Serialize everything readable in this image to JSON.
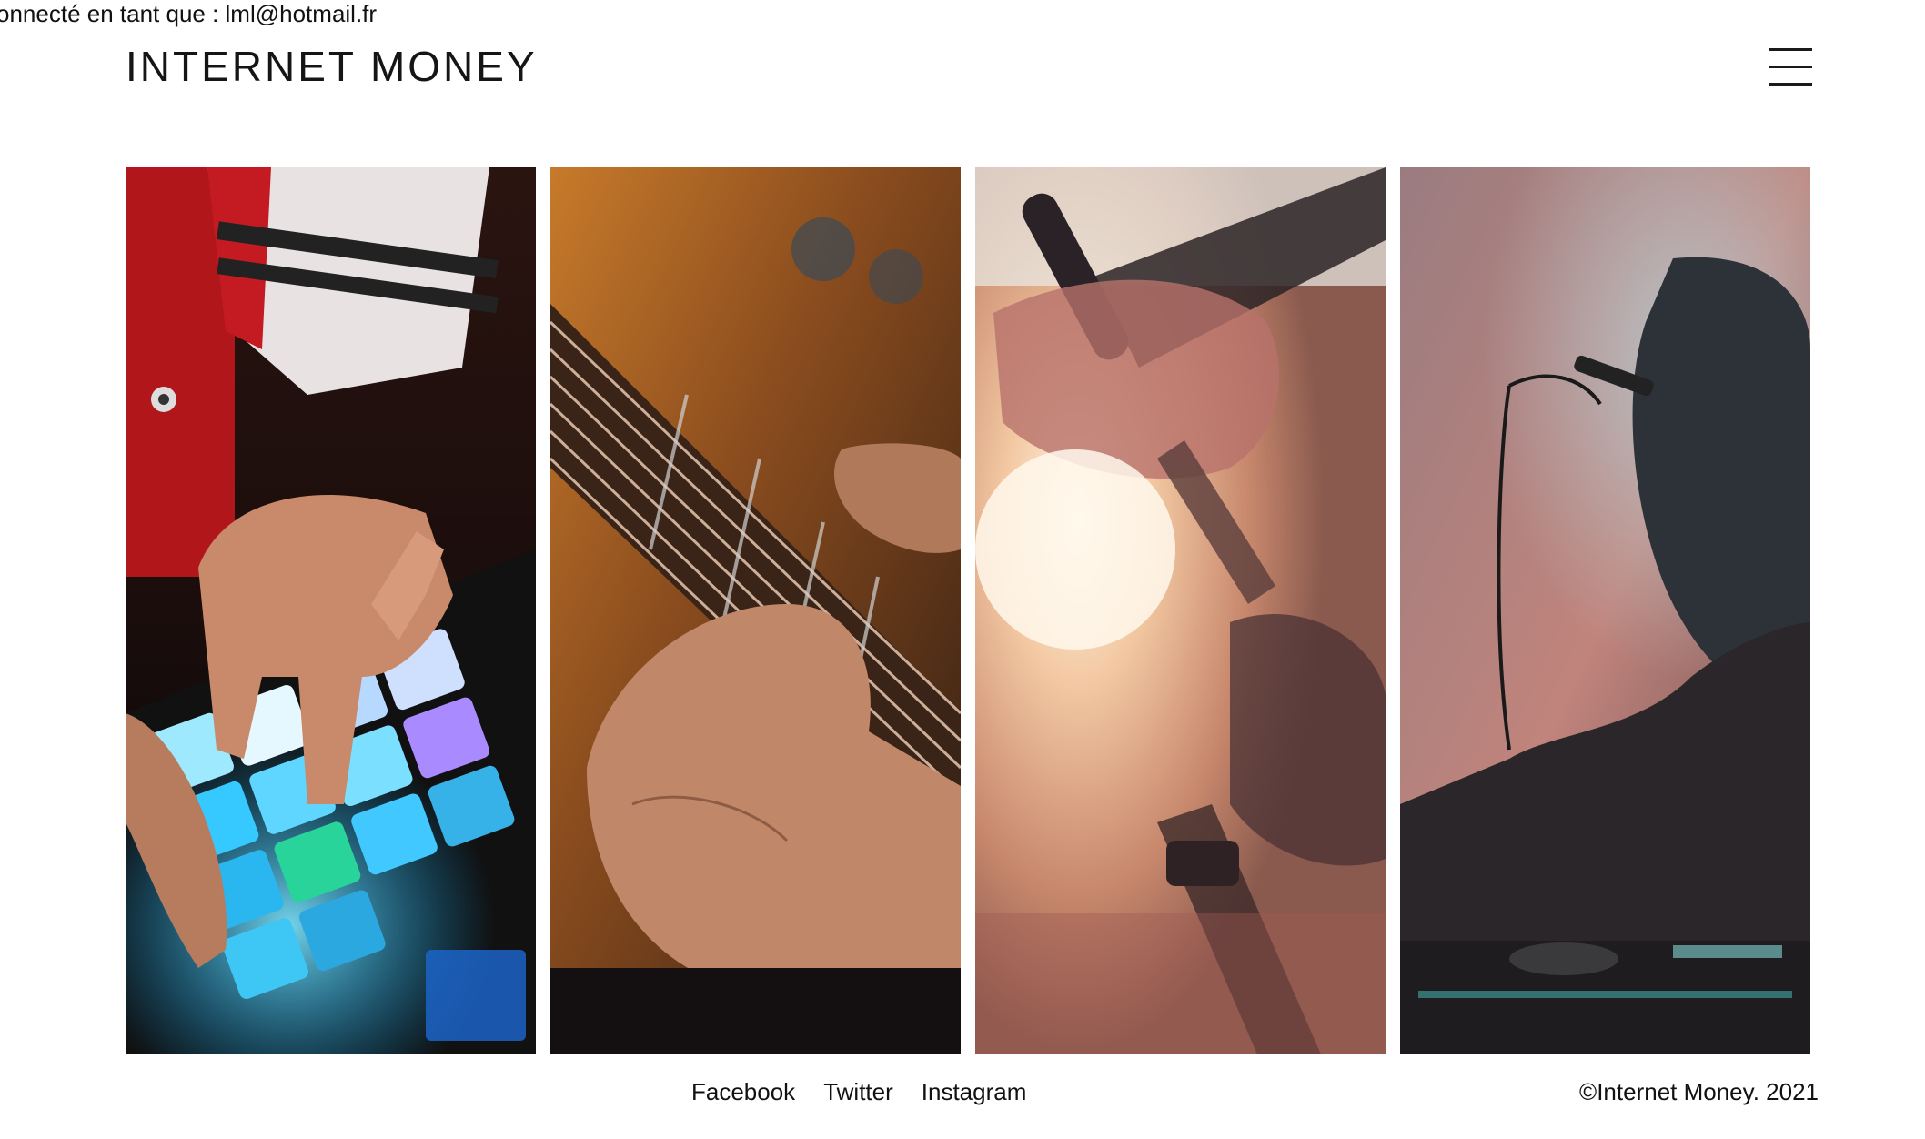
{
  "session": {
    "login_status": "onnecté en tant que : lml@hotmail.fr"
  },
  "header": {
    "brand": "INTERNET MONEY",
    "menu_icon": "hamburger-menu-icon"
  },
  "gallery": {
    "images": [
      {
        "subject": "hands playing a pad controller"
      },
      {
        "subject": "hand on guitar strings"
      },
      {
        "subject": "microphone stand in bright light"
      },
      {
        "subject": "DJ in smoke with turntable"
      }
    ]
  },
  "footer": {
    "links": [
      "Facebook",
      "Twitter",
      "Instagram"
    ],
    "copyright": "©Internet Money. 2021"
  }
}
